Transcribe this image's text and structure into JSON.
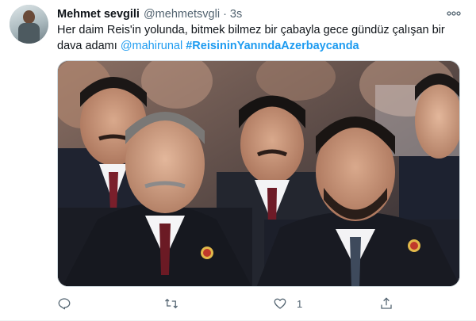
{
  "tweet": {
    "author_name": "Mehmet sevgili",
    "author_handle": "@mehmetsvgli",
    "separator": "·",
    "time": "3s",
    "text_line1": "Her daim Reis'in yolunda, bitmek bilmez bir çabayla gece gündüz çalışan bir",
    "text_line2_plain": "dava adamı ",
    "mention": "@mahirunal",
    "hashtag": "#ReisininYanındaAzerbaycanda",
    "like_count": "1"
  },
  "icons": {
    "more": "more-horizontal-icon",
    "reply": "reply-icon",
    "retweet": "retweet-icon",
    "like": "heart-icon",
    "share": "share-icon"
  },
  "colors": {
    "link": "#1d9bf0",
    "secondary_text": "#536471",
    "primary_text": "#0f1419"
  }
}
